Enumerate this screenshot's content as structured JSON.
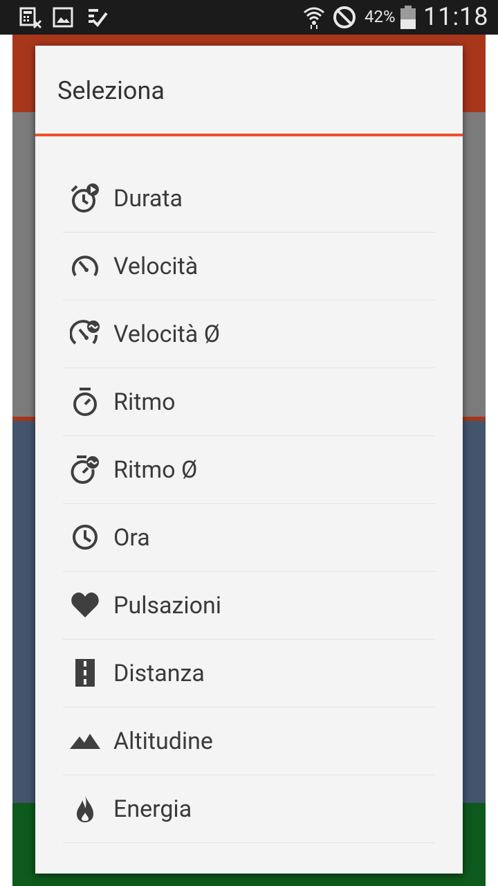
{
  "status_bar": {
    "battery_percent": "42%",
    "time": "11:18"
  },
  "dialog": {
    "title": "Seleziona",
    "accent_color": "#f0502a",
    "options": [
      {
        "label": "Durata",
        "icon": "stopwatch-play-icon"
      },
      {
        "label": "Velocità",
        "icon": "speedometer-icon"
      },
      {
        "label": "Velocità Ø",
        "icon": "speedometer-average-icon"
      },
      {
        "label": "Ritmo",
        "icon": "stopwatch-icon"
      },
      {
        "label": "Ritmo Ø",
        "icon": "stopwatch-average-icon"
      },
      {
        "label": "Ora",
        "icon": "clock-icon"
      },
      {
        "label": "Pulsazioni",
        "icon": "heart-icon"
      },
      {
        "label": "Distanza",
        "icon": "road-icon"
      },
      {
        "label": "Altitudine",
        "icon": "mountain-icon"
      },
      {
        "label": "Energia",
        "icon": "flame-icon"
      }
    ]
  }
}
